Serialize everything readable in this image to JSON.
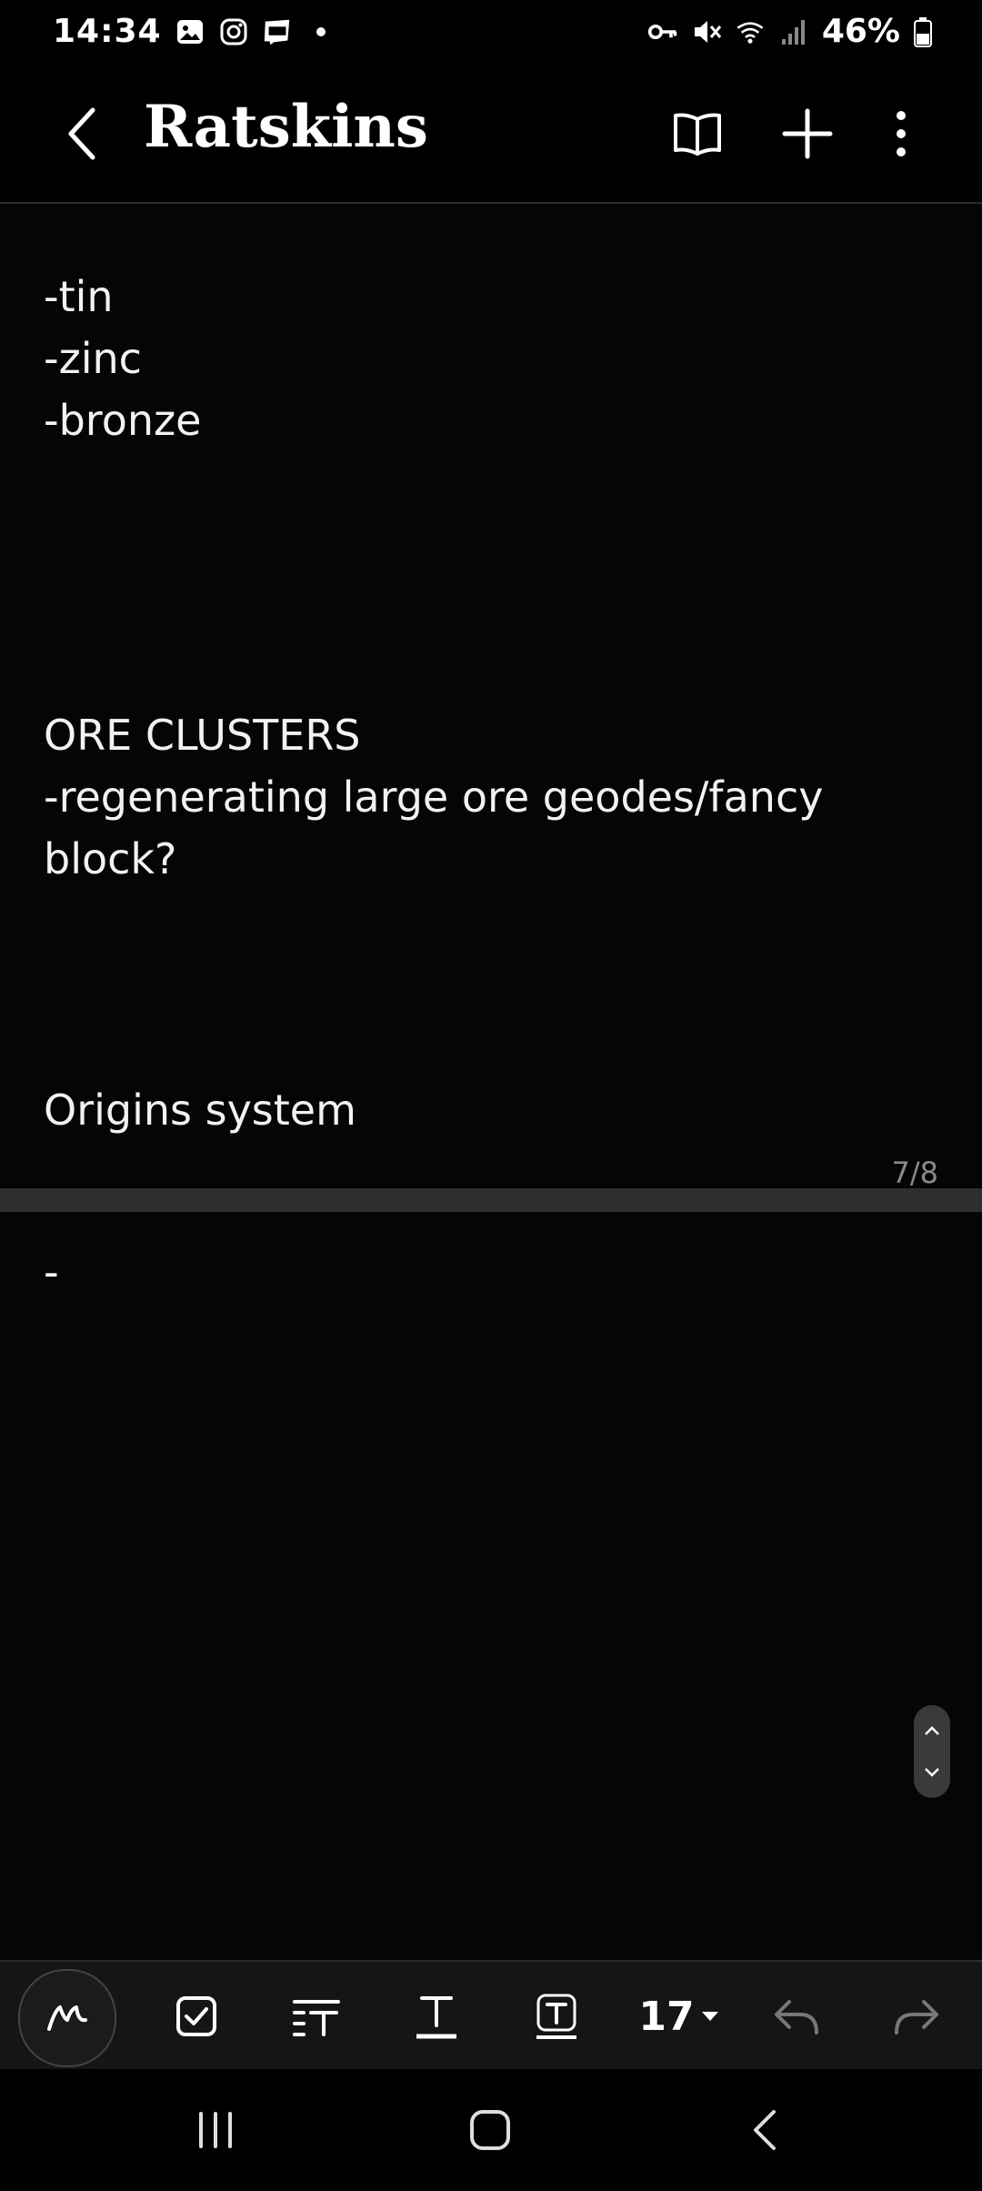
{
  "status_bar": {
    "time": "14:34",
    "battery_text": "46%",
    "left_icons": [
      "gallery-icon",
      "instagram-icon",
      "webtoon-icon",
      "dot-icon"
    ],
    "right_icons": [
      "vpn-key-icon",
      "mute-icon",
      "wifi-icon",
      "signal-icon",
      "battery-icon"
    ]
  },
  "app_bar": {
    "title": "Ratskins",
    "icons": [
      "back-arrow-icon",
      "book-icon",
      "add-icon",
      "more-vert-icon"
    ]
  },
  "page1": {
    "lines": [
      "-tin",
      "-zinc",
      "-bronze",
      "ORE CLUSTERS",
      "-regenerating large ore geodes/fancy",
      "block?",
      "Origins system"
    ],
    "page_indicator": "7/8"
  },
  "page2": {
    "lines": [
      "-"
    ]
  },
  "toolbar": {
    "font_size": "17",
    "icons": [
      "pen-icon",
      "checkbox-icon",
      "text-format-icon",
      "text-underline-icon",
      "text-box-icon",
      "chevron-down-icon",
      "undo-icon",
      "redo-icon"
    ]
  },
  "nav_bar": {
    "icons": [
      "recents-icon",
      "home-icon",
      "back-icon"
    ]
  },
  "colors": {
    "background": "#000000",
    "page": "#050505",
    "separator": "#2e2e2e",
    "toolbar": "#151515",
    "text": "#f2f2f2",
    "muted": "#8a8a8a"
  }
}
